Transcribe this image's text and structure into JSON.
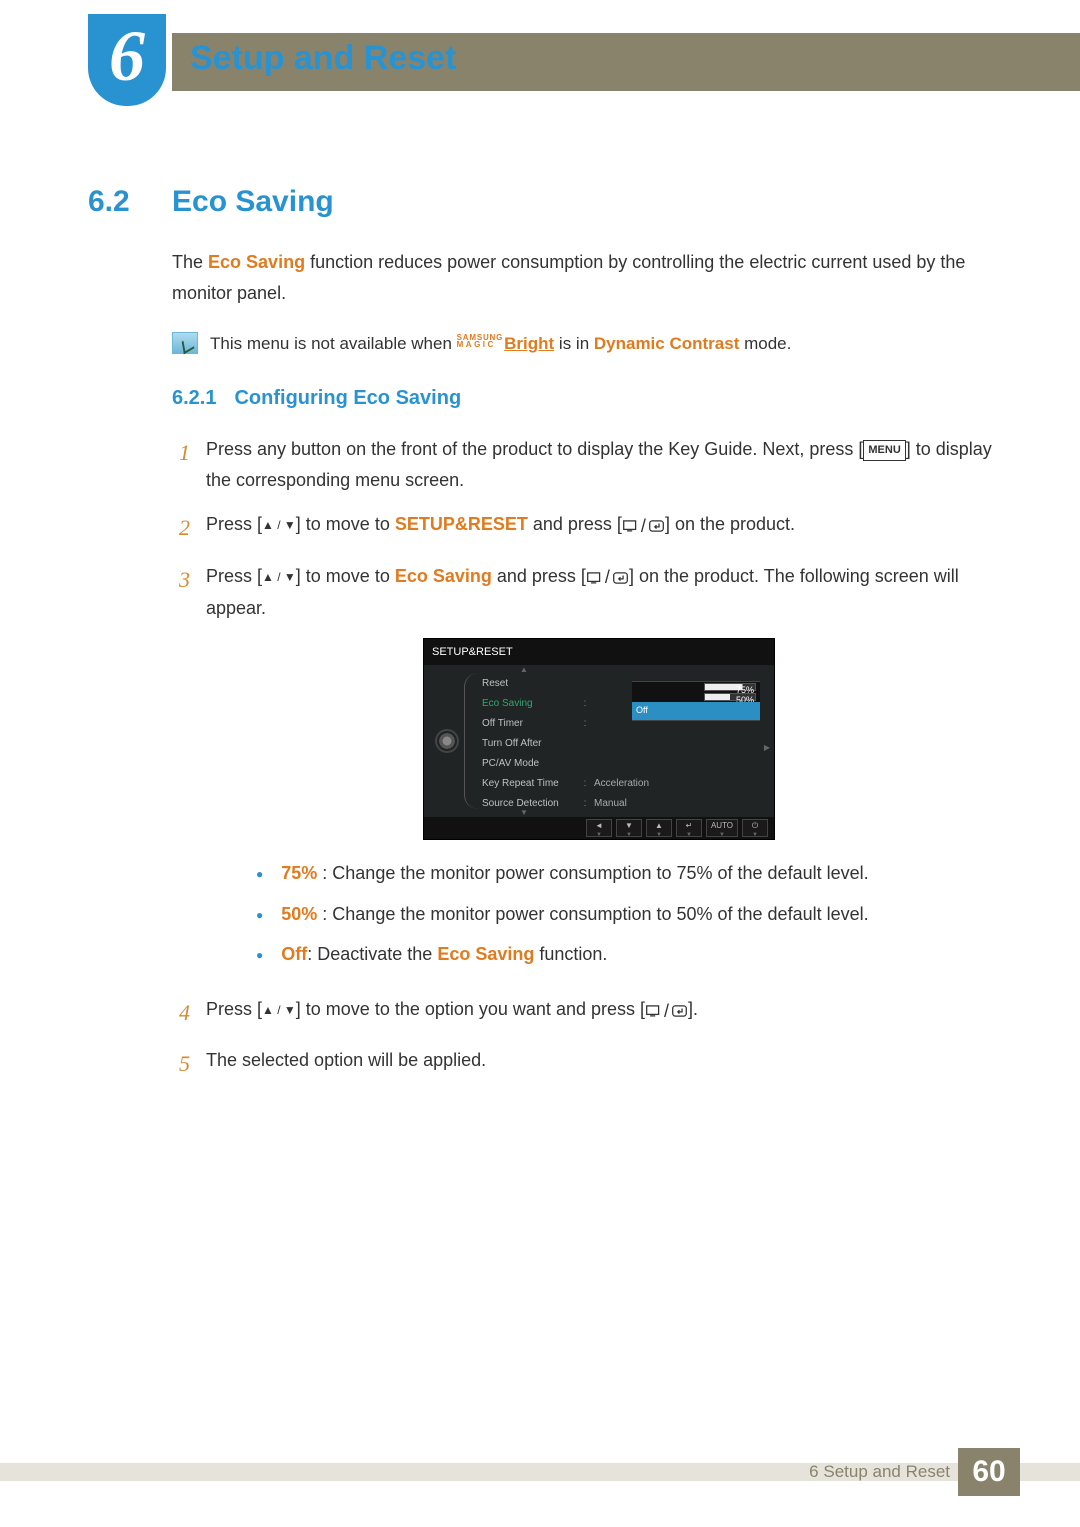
{
  "chapter": {
    "number": "6",
    "title": "Setup and Reset"
  },
  "section": {
    "number": "6.2",
    "title": "Eco Saving"
  },
  "intro": {
    "pre": "The ",
    "term": "Eco Saving",
    "post": " function reduces power consumption by controlling the electric current used by the monitor panel."
  },
  "note": {
    "pre": "This menu is not available when ",
    "logo_top": "SAMSUNG",
    "logo_bot": "MAGIC",
    "bright": "Bright",
    "mid": " is in ",
    "mode": "Dynamic Contrast",
    "post": " mode."
  },
  "subsection": {
    "number": "6.2.1",
    "title": "Configuring Eco Saving"
  },
  "steps": {
    "s1": {
      "n": "1",
      "a": "Press any button on the front of the product to display the Key Guide. Next, press [",
      "menu": "MENU",
      "b": "] to display the corresponding menu screen."
    },
    "s2": {
      "n": "2",
      "a": "Press [",
      "b": "] to move to ",
      "target": "SETUP&RESET",
      "c": " and press [",
      "d": "] on the product."
    },
    "s3": {
      "n": "3",
      "a": "Press [",
      "b": "] to move to ",
      "target": "Eco Saving",
      "c": " and press [",
      "d": "] on the product. The following screen will appear."
    },
    "s4": {
      "n": "4",
      "a": "Press [",
      "b": "] to move to the option you want and press [",
      "c": "]."
    },
    "s5": {
      "n": "5",
      "a": "The selected option will be applied."
    }
  },
  "osd": {
    "title": "SETUP&RESET",
    "items": {
      "reset": "Reset",
      "eco": "Eco Saving",
      "offtimer": "Off Timer",
      "turnoff": "Turn Off After",
      "pcav": "PC/AV Mode",
      "keyrepeat": {
        "label": "Key Repeat Time",
        "value": "Acceleration"
      },
      "srcdet": {
        "label": "Source Detection",
        "value": "Manual"
      }
    },
    "popup": {
      "p75": "75%",
      "p50": "50%",
      "off": "Off"
    },
    "foot_auto": "AUTO"
  },
  "bullets": {
    "b1": {
      "term": "75%",
      "text": " : Change the monitor power consumption to 75% of the default level."
    },
    "b2": {
      "term": "50%",
      "text": " : Change the monitor power consumption to 50% of the default level."
    },
    "b3": {
      "term": "Off",
      "mid": ": Deactivate the ",
      "eco": "Eco Saving",
      "post": " function."
    }
  },
  "footer": {
    "text": "6 Setup and Reset",
    "page": "60"
  }
}
